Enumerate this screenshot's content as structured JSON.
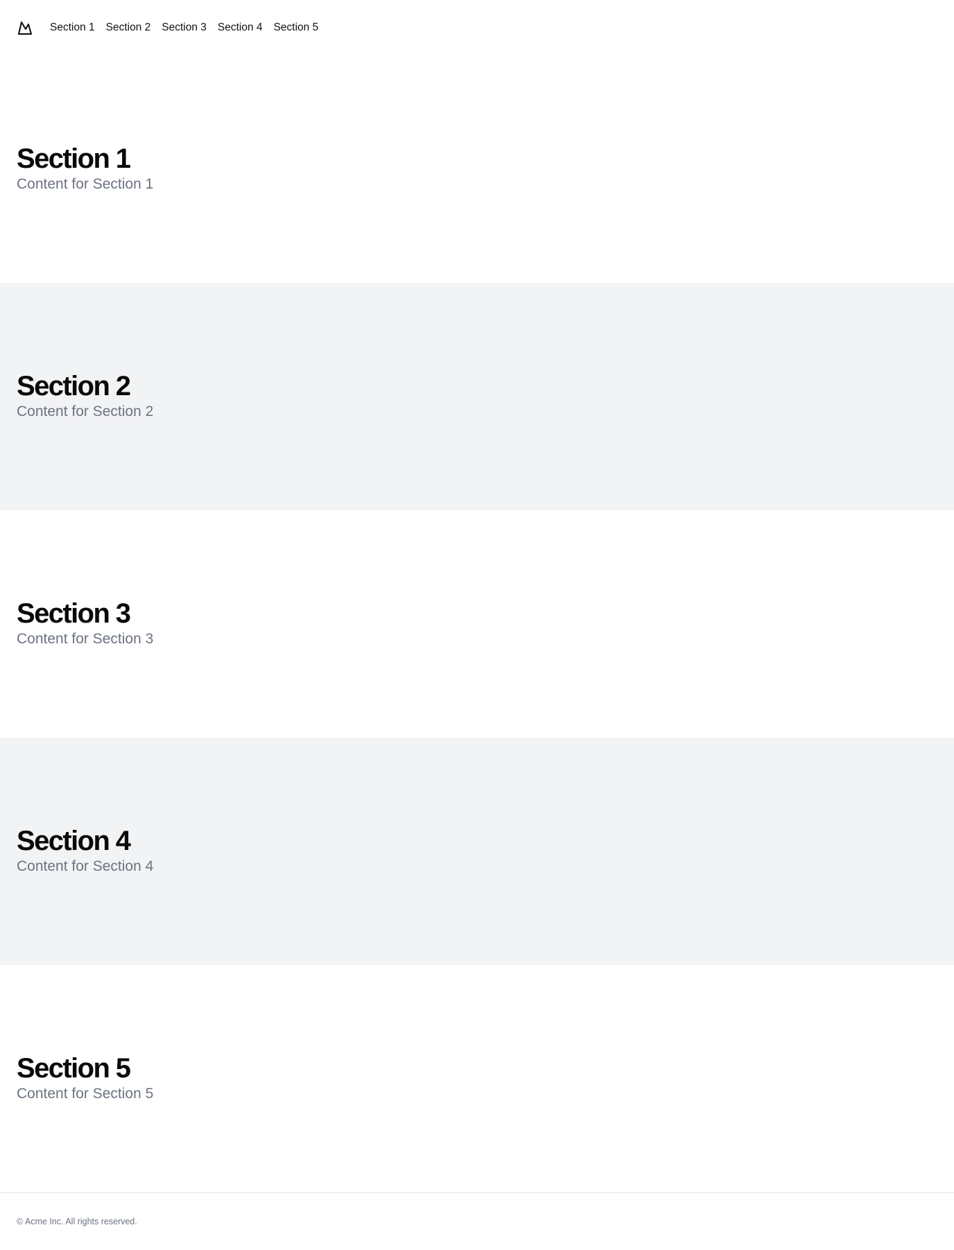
{
  "header": {
    "logo_icon": "mountain-icon",
    "nav": [
      {
        "label": "Section 1"
      },
      {
        "label": "Section 2"
      },
      {
        "label": "Section 3"
      },
      {
        "label": "Section 4"
      },
      {
        "label": "Section 5"
      }
    ]
  },
  "sections": [
    {
      "title": "Section 1",
      "content": "Content for Section 1"
    },
    {
      "title": "Section 2",
      "content": "Content for Section 2"
    },
    {
      "title": "Section 3",
      "content": "Content for Section 3"
    },
    {
      "title": "Section 4",
      "content": "Content for Section 4"
    },
    {
      "title": "Section 5",
      "content": "Content for Section 5"
    }
  ],
  "footer": {
    "text": "© Acme Inc. All rights reserved."
  },
  "colors": {
    "alt_section_bg": "#f2f3f5",
    "muted_text": "#6b7280",
    "heading_text": "#0a0a0a"
  }
}
